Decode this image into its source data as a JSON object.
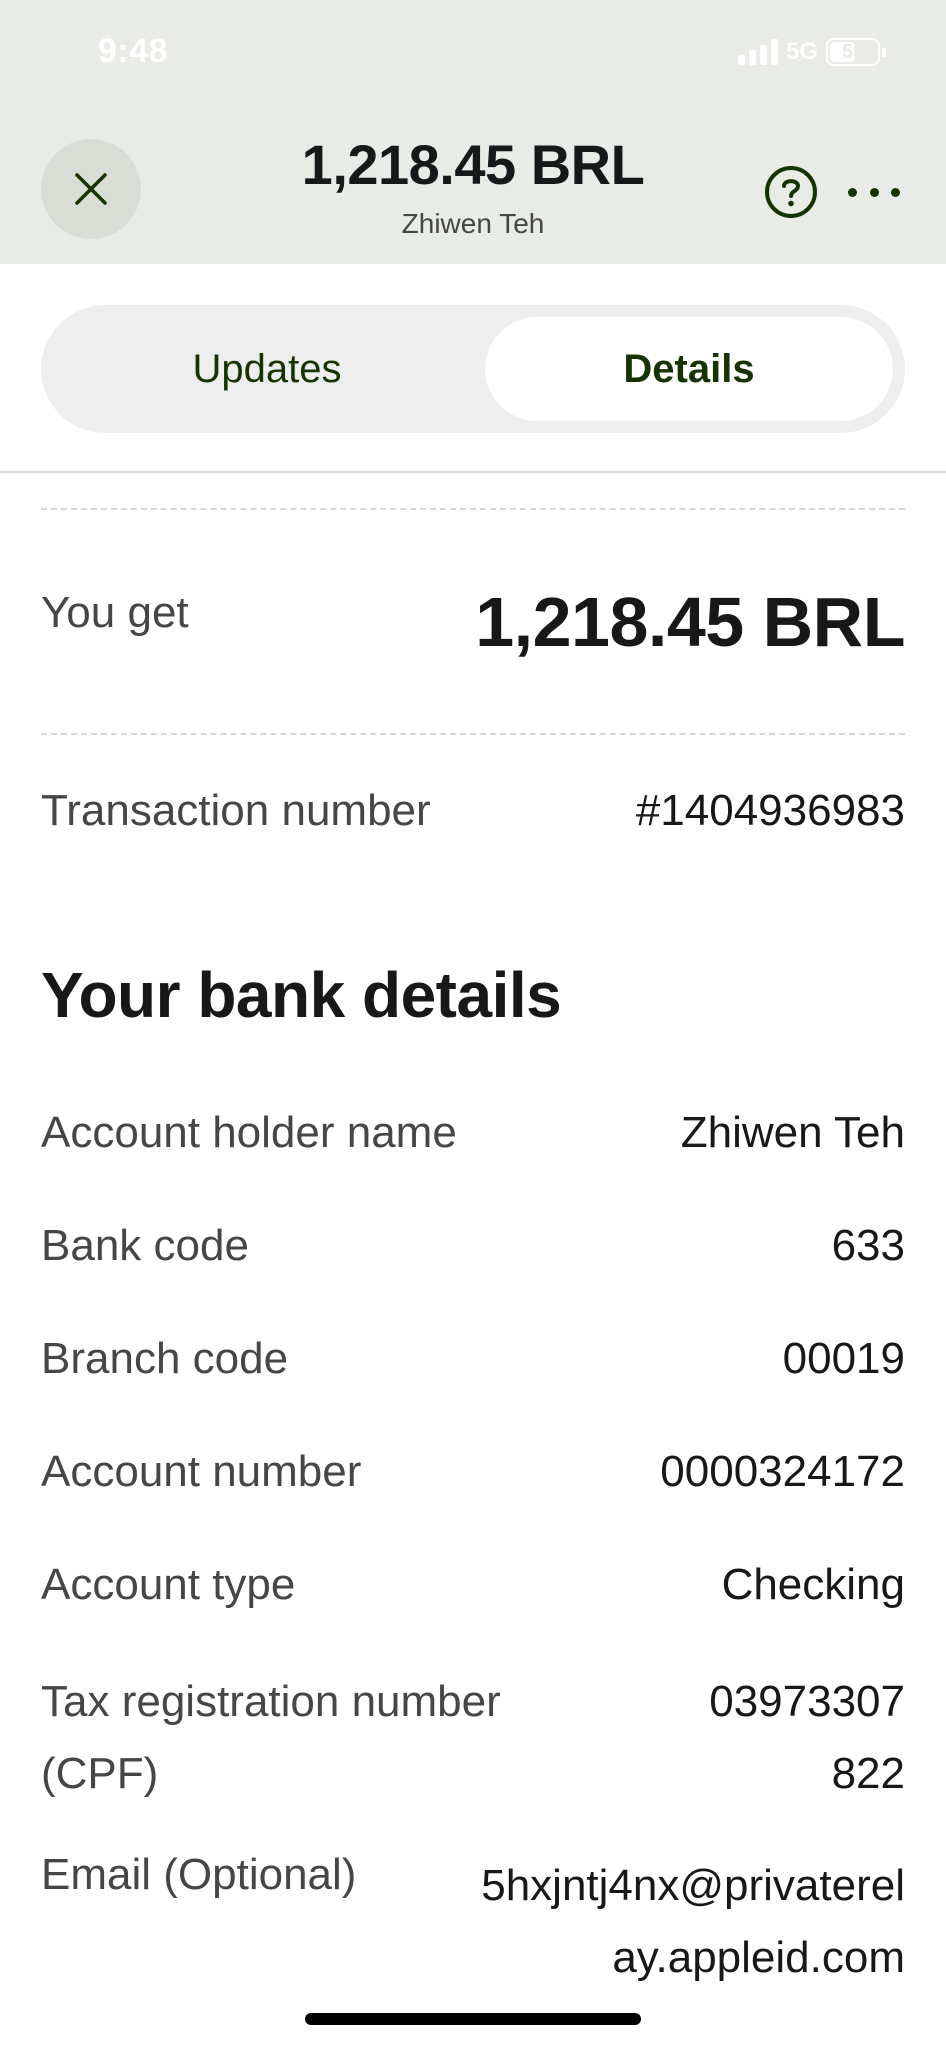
{
  "status_bar": {
    "time": "9:48",
    "network": "5G",
    "battery": "55"
  },
  "header": {
    "amount": "1,218.45 BRL",
    "recipient": "Zhiwen Teh"
  },
  "tabs": [
    {
      "label": "Updates",
      "selected": false
    },
    {
      "label": "Details",
      "selected": true
    }
  ],
  "summary": {
    "you_get_label": "You get",
    "you_get_value": "1,218.45 BRL",
    "transaction_label": "Transaction number",
    "transaction_value": "#1404936983"
  },
  "bank_details": {
    "title": "Your bank details",
    "rows": [
      {
        "label": "Account holder name",
        "value": "Zhiwen Teh"
      },
      {
        "label": "Bank code",
        "value": "633"
      },
      {
        "label": "Branch code",
        "value": "00019"
      },
      {
        "label": "Account number",
        "value": "0000324172"
      },
      {
        "label": "Account type",
        "value": "Checking"
      },
      {
        "label_line1": "Tax registration number",
        "label_line2": "(CPF)",
        "value_line1": "03973307",
        "value_line2": "822"
      },
      {
        "label": "Email (Optional)",
        "value_line1": "5hxjntj4nx@privaterel",
        "value_line2": "ay.appleid.com"
      }
    ]
  },
  "colors": {
    "header_bg": "#e8ebe6",
    "accent": "#163300",
    "segment_bg": "#eeeeee"
  }
}
